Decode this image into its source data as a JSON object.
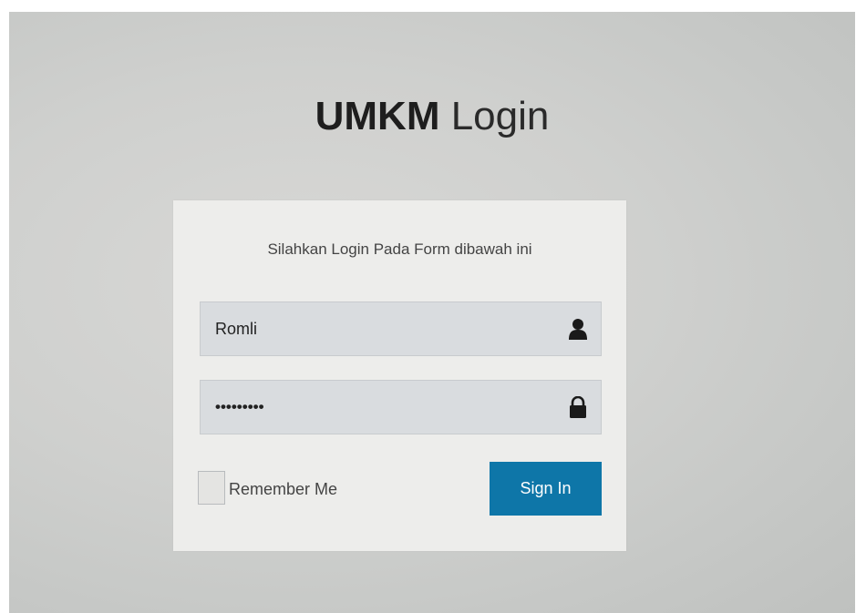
{
  "header": {
    "brand_bold": "UMKM",
    "brand_light": " Login"
  },
  "login_form": {
    "message": "Silahkan Login Pada Form dibawah ini",
    "username": {
      "value": "Romli",
      "icon": "user-icon"
    },
    "password": {
      "value": "•••••••••",
      "icon": "lock-icon"
    },
    "remember_label": "Remember Me",
    "remember_checked": false,
    "submit_label": "Sign In"
  },
  "colors": {
    "accent": "#0e76a8",
    "card_bg": "#ededeb",
    "field_bg": "#d9dcdf"
  }
}
